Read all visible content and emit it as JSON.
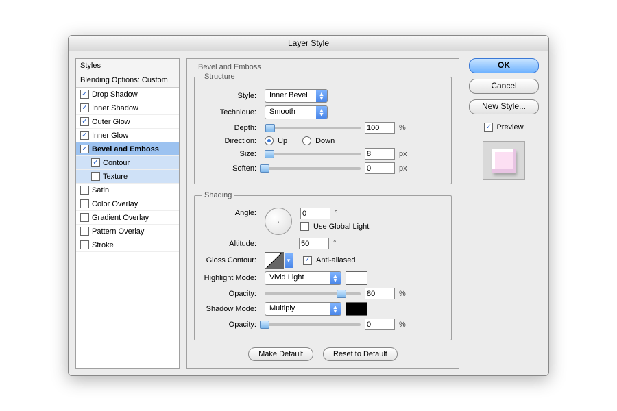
{
  "window": {
    "title": "Layer Style"
  },
  "list": {
    "styles_header": "Styles",
    "blending_header": "Blending Options: Custom",
    "items": [
      {
        "label": "Drop Shadow",
        "checked": true
      },
      {
        "label": "Inner Shadow",
        "checked": true
      },
      {
        "label": "Outer Glow",
        "checked": true
      },
      {
        "label": "Inner Glow",
        "checked": true
      },
      {
        "label": "Bevel and Emboss",
        "checked": true,
        "selected": true
      },
      {
        "label": "Contour",
        "checked": true,
        "child": true
      },
      {
        "label": "Texture",
        "checked": false,
        "child": true
      },
      {
        "label": "Satin",
        "checked": false
      },
      {
        "label": "Color Overlay",
        "checked": false
      },
      {
        "label": "Gradient Overlay",
        "checked": false
      },
      {
        "label": "Pattern Overlay",
        "checked": false
      },
      {
        "label": "Stroke",
        "checked": false
      }
    ]
  },
  "panel": {
    "title": "Bevel and Emboss",
    "structure": {
      "legend": "Structure",
      "style_label": "Style:",
      "style_value": "Inner Bevel",
      "technique_label": "Technique:",
      "technique_value": "Smooth",
      "depth_label": "Depth:",
      "depth_value": "100",
      "depth_unit": "%",
      "direction_label": "Direction:",
      "direction_up": "Up",
      "direction_down": "Down",
      "size_label": "Size:",
      "size_value": "8",
      "size_unit": "px",
      "soften_label": "Soften:",
      "soften_value": "0",
      "soften_unit": "px"
    },
    "shading": {
      "legend": "Shading",
      "angle_label": "Angle:",
      "angle_value": "0",
      "altitude_label": "Altitude:",
      "altitude_value": "50",
      "global_light": "Use Global Light",
      "gloss_label": "Gloss Contour:",
      "anti_aliased": "Anti-aliased",
      "highlight_label": "Highlight Mode:",
      "highlight_value": "Vivid Light",
      "highlight_swatch": "#ffffff",
      "shadow_label": "Shadow Mode:",
      "shadow_value": "Multiply",
      "shadow_swatch": "#000000",
      "opacity_label": "Opacity:",
      "h_opacity": "80",
      "s_opacity": "0"
    },
    "make_default": "Make Default",
    "reset_default": "Reset to Default"
  },
  "right": {
    "ok": "OK",
    "cancel": "Cancel",
    "new_style": "New Style...",
    "preview": "Preview"
  }
}
